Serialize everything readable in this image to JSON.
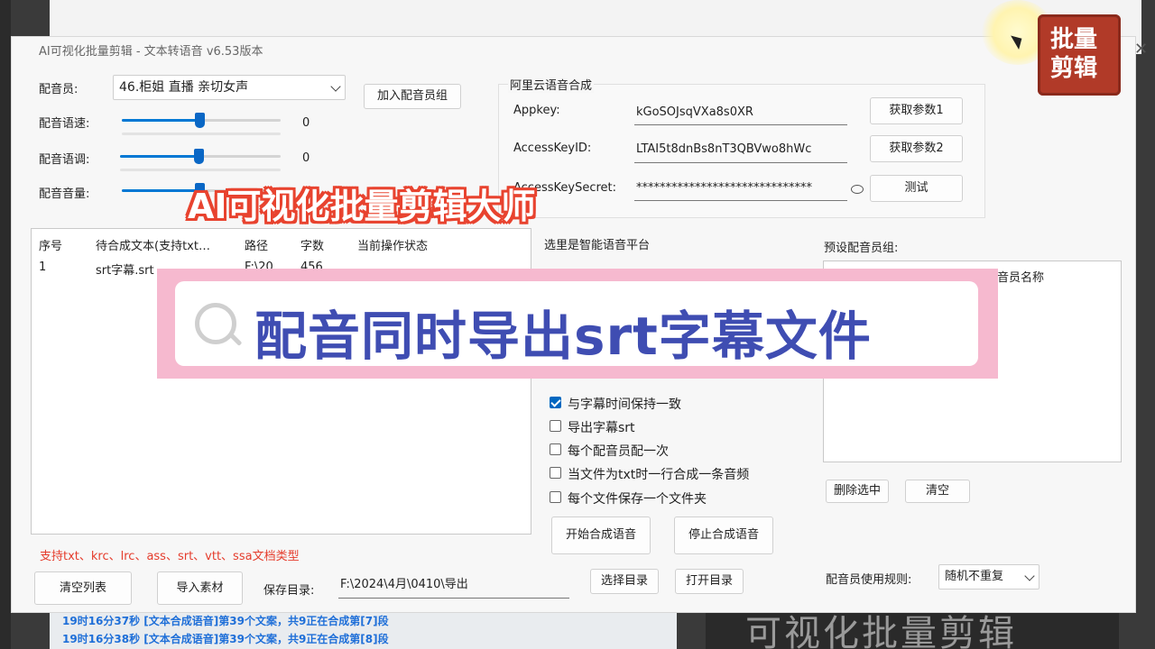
{
  "background": {
    "log_lines": [
      "19时16分37秒   [文本合成语音]第39个文案，共9正在合成第[7]段",
      "19时16分38秒   [文本合成语音]第39个文案，共9正在合成第[8]段"
    ],
    "video_text": "可视化批量剪辑",
    "logo": [
      "批量",
      "剪辑"
    ]
  },
  "window": {
    "title": "AI可视化批量剪辑 -  文本转语音  v6.53版本"
  },
  "voice": {
    "speaker_label": "配音员:",
    "speaker_value": "46.柜姐 直播 亲切女声",
    "add_group_button": "加入配音员组",
    "speed_label": "配音语速:",
    "speed_value": "0",
    "pitch_label": "配音语调:",
    "pitch_value": "0",
    "volume_label": "配音音量:",
    "speed_level": 0.5,
    "pitch_level": 0.5,
    "volume_level": 0.5
  },
  "aliyun": {
    "group_title": "阿里云语音合成",
    "appkey_label": "Appkey:",
    "appkey_value": "kGoSOJsqVXa8s0XR",
    "get_param1": "获取参数1",
    "keyid_label": "AccessKeyID:",
    "keyid_value": "LTAI5t8dnBs8nT3QBVwo8hWc",
    "get_param2": "获取参数2",
    "secret_label": "AccessKeySecret:",
    "secret_value": "******************************",
    "test_button": "测试"
  },
  "table": {
    "headers": [
      "序号",
      "待合成文本(支持txt…",
      "路径",
      "字数",
      "当前操作状态"
    ],
    "rows": [
      [
        "1",
        "srt字幕.srt",
        "F:\\20",
        "456",
        ""
      ]
    ]
  },
  "platform_label": "选里是智能语音平台",
  "options": [
    {
      "label": "与字幕时间保持一致",
      "checked": true
    },
    {
      "label": "导出字幕srt",
      "checked": false
    },
    {
      "label": "每个配音员配一次",
      "checked": false
    },
    {
      "label": "当文件为txt时一行合成一条音频",
      "checked": false
    },
    {
      "label": "每个文件保存一个文件夹",
      "checked": false
    }
  ],
  "preset": {
    "label": "预设配音员组:",
    "column": "音员名称",
    "delete_button": "删除选中",
    "clear_button": "清空",
    "rule_label": "配音员使用规则:",
    "rule_value": "随机不重复"
  },
  "actions": {
    "start": "开始合成语音",
    "stop": "停止合成语音"
  },
  "bottom": {
    "support_text": "支持txt、krc、lrc、ass、srt、vtt、ssa文档类型",
    "clear_list": "清空列表",
    "import": "导入素材",
    "save_label": "保存目录:",
    "save_path": "F:\\2024\\4月\\0410\\导出",
    "choose_dir": "选择目录",
    "open_dir": "打开目录"
  },
  "overlay": {
    "title": "AI可视化批量剪辑大师",
    "banner": "配音同时导出srt字幕文件"
  }
}
